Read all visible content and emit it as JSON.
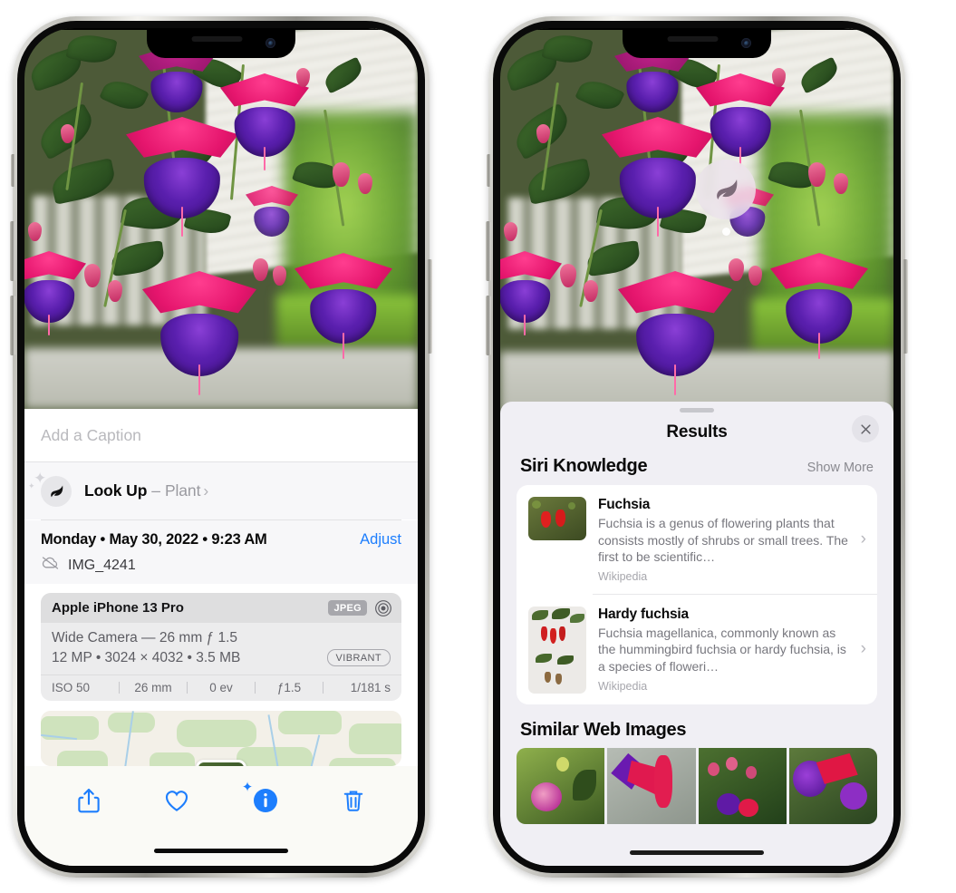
{
  "left_phone": {
    "photo": {
      "alt_name": "fuchsia-flowers-photo"
    },
    "caption_placeholder": "Add a Caption",
    "lookup": {
      "label": "Look Up",
      "dash": "–",
      "subject": "Plant",
      "chevron": "›",
      "icon": "leaf-icon"
    },
    "metadata": {
      "date": "Monday • May 30, 2022 • 9:23 AM",
      "adjust_label": "Adjust",
      "filename": "IMG_4241",
      "cloud_icon": "cloud-slash-icon"
    },
    "exif": {
      "device": "Apple iPhone 13 Pro",
      "format_badge": "JPEG",
      "aperture_icon": "aperture-icon",
      "lens_line": "Wide Camera — 26 mm ƒ 1.5",
      "size_line": "12 MP • 3024 × 4032 • 3.5 MB",
      "style_badge": "VIBRANT",
      "stats": [
        "ISO 50",
        "26 mm",
        "0 ev",
        "ƒ1.5",
        "1/181 s"
      ]
    },
    "toolbar": [
      {
        "name": "share-button",
        "icon": "share-icon"
      },
      {
        "name": "favorite-button",
        "icon": "heart-icon"
      },
      {
        "name": "info-button",
        "icon": "info-sparkle-icon"
      },
      {
        "name": "delete-button",
        "icon": "trash-icon"
      }
    ],
    "accent_color": "#1d7efd"
  },
  "right_phone": {
    "badge": {
      "icon": "leaf-icon",
      "name": "visual-lookup-badge"
    },
    "sheet": {
      "title": "Results",
      "close_icon": "close-icon"
    },
    "siri_knowledge": {
      "heading": "Siri Knowledge",
      "action": "Show More",
      "items": [
        {
          "title": "Fuchsia",
          "description": "Fuchsia is a genus of flowering plants that consists mostly of shrubs or small trees. The first to be scientific…",
          "source": "Wikipedia",
          "chevron": "›"
        },
        {
          "title": "Hardy fuchsia",
          "description": "Fuchsia magellanica, commonly known as the hummingbird fuchsia or hardy fuchsia, is a species of floweri…",
          "source": "Wikipedia",
          "chevron": "›"
        }
      ]
    },
    "similar_web_images": {
      "heading": "Similar Web Images",
      "count": 4
    }
  }
}
